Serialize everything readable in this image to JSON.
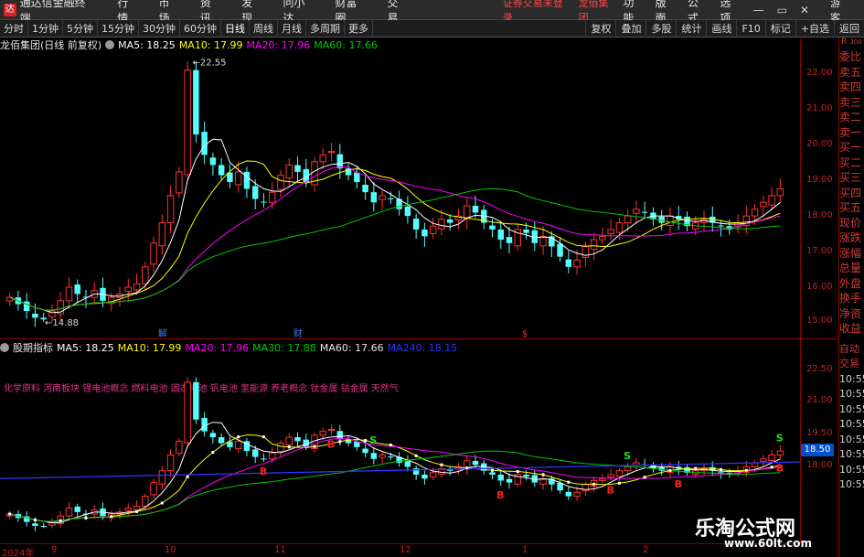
{
  "titlebar": {
    "app_title": "通达信金融终端",
    "menus": [
      "行情",
      "市场",
      "资讯",
      "发现",
      "问小达",
      "财富圈",
      "交易"
    ],
    "login_hint": "证券交易未登录",
    "stock_name": "龙佰集团",
    "right_menus": [
      "功能",
      "版面",
      "公式",
      "选项"
    ],
    "guest": "游客"
  },
  "toolbar": {
    "periods": [
      "分时",
      "1分钟",
      "5分钟",
      "15分钟",
      "30分钟",
      "60分钟",
      "日线",
      "周线",
      "月线",
      "多周期",
      "更多"
    ],
    "active_period": "日线",
    "right_tools": [
      "复权",
      "叠加",
      "多股",
      "统计",
      "画线",
      "F10",
      "标记",
      "+自选",
      "返回"
    ]
  },
  "main_header": {
    "title": "龙佰集团(日线 前复权)",
    "ma5": "MA5: 18.25",
    "ma10": "MA10: 17.99",
    "ma20": "MA20: 17.96",
    "ma60": "MA60: 17.66"
  },
  "sub_header": {
    "title": "股期指标",
    "ma5": "MA5: 18.25",
    "ma10": "MA10: 17.99",
    "ma20": "MA20: 17.96",
    "ma30": "MA30: 17.88",
    "ma60": "MA60: 17.66",
    "ma240": "MA240: 18.15"
  },
  "concepts": "化学原料 河南板块 锂电池概念 燃料电池 固态电池 钒电池 氢能源 养老概念 钛金属 钴金属 天然气",
  "main_axis_ticks": [
    "22.00",
    "21.00",
    "20.00",
    "19.00",
    "18.00",
    "17.00",
    "16.00",
    "15.00"
  ],
  "sub_axis_ticks": [
    "22.50",
    "21.00",
    "19.50",
    "18.00"
  ],
  "price_box": "18.50",
  "high_label": "22.55",
  "low_label": "14.88",
  "event_markers": [
    "解",
    "财",
    "$"
  ],
  "signal_B": "B",
  "signal_S": "S",
  "x_labels": [
    "2024年",
    "9",
    "10",
    "11",
    "12",
    "1",
    "2"
  ],
  "sidepanel": {
    "top_label": "R",
    "top_num": "300",
    "items": [
      "委比",
      "卖五",
      "卖四",
      "卖三",
      "卖二",
      "卖一",
      "买一",
      "买二",
      "买三",
      "买四",
      "买五",
      "现价",
      "涨跌",
      "涨幅",
      "总量",
      "外盘",
      "换手",
      "净资",
      "收益"
    ],
    "lower_items": [
      "自动",
      "交易",
      "10:55",
      "10:55",
      "10:55",
      "10:55",
      "10:55",
      "10:55",
      "10:55",
      "10:55"
    ]
  },
  "watermark": {
    "text": "乐淘公式网",
    "url": "www.60lt.com"
  },
  "colors": {
    "up": "#ff3232",
    "down": "#54fcfc",
    "ma5": "#ffffff",
    "ma10": "#ffff00",
    "ma20": "#ff00ff",
    "ma60": "#00c800",
    "ma240": "#3232ff",
    "axis": "#c81e1e"
  },
  "chart_data": {
    "type": "line",
    "title": "龙佰集团(日线 前复权)",
    "ylim": [
      14.5,
      22.8
    ],
    "price_high": 22.55,
    "price_low": 14.88,
    "series": [
      {
        "name": "MA5",
        "last": 18.25
      },
      {
        "name": "MA10",
        "last": 17.99
      },
      {
        "name": "MA20",
        "last": 17.96
      },
      {
        "name": "MA60",
        "last": 17.66
      }
    ],
    "close_approx": [
      15.6,
      15.4,
      15.2,
      15.0,
      14.95,
      15.2,
      15.5,
      15.9,
      15.7,
      15.6,
      15.8,
      15.5,
      15.6,
      15.7,
      15.9,
      16.0,
      16.5,
      17.2,
      17.8,
      18.6,
      19.3,
      22.3,
      20.4,
      19.8,
      19.5,
      19.2,
      19.0,
      19.3,
      18.8,
      18.5,
      18.4,
      18.7,
      19.2,
      19.5,
      19.3,
      19.0,
      19.6,
      19.8,
      19.9,
      19.4,
      19.2,
      19.0,
      18.7,
      18.4,
      18.6,
      18.5,
      18.2,
      18.0,
      17.6,
      17.4,
      17.7,
      17.9,
      17.8,
      18.0,
      18.3,
      18.1,
      17.8,
      17.6,
      17.3,
      17.2,
      17.6,
      17.5,
      17.2,
      17.4,
      17.1,
      16.8,
      16.5,
      16.7,
      17.1,
      17.3,
      17.4,
      17.6,
      17.8,
      18.0,
      18.2,
      18.1,
      17.9,
      17.8,
      18.0,
      17.9,
      17.7,
      17.8,
      17.9,
      17.8,
      17.7,
      17.6,
      17.8,
      18.0,
      18.2,
      18.4,
      18.6,
      18.8
    ]
  }
}
